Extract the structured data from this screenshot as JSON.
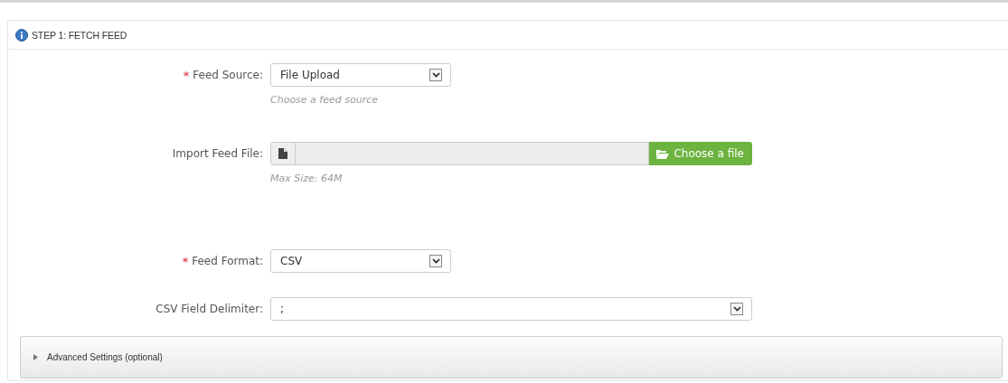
{
  "panel": {
    "title": "STEP 1: FETCH FEED"
  },
  "fields": [
    {
      "kind": "select",
      "label": "Feed Source:",
      "required_mark": "*",
      "value": "File Upload",
      "help": "Choose a feed source"
    },
    {
      "kind": "file",
      "label": "Import Feed File:",
      "button": "Choose a file",
      "help": "Max Size: 64M"
    },
    {
      "kind": "select",
      "label": "Feed Format:",
      "required_mark": "*",
      "value": "CSV"
    },
    {
      "kind": "wideselect",
      "label": "CSV Field Delimiter:",
      "value": ";"
    }
  ],
  "advanced": {
    "label": "Advanced Settings (optional)",
    "expanded": false
  }
}
